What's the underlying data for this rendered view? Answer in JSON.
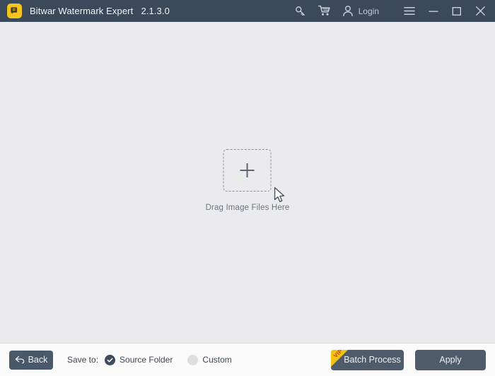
{
  "window": {
    "app_icon": "app-logo-icon",
    "title": "Bitwar Watermark Expert",
    "version": "2.1.3.0"
  },
  "titlebar": {
    "actions": [
      {
        "name": "key-icon",
        "label": "",
        "title": "Activate"
      },
      {
        "name": "cart-icon",
        "label": "",
        "title": "Store"
      },
      {
        "name": "user-icon",
        "label": "Login"
      }
    ],
    "login_label": "Login",
    "menu_icon": "hamburger-menu-icon",
    "minimize_icon": "minimize-icon",
    "maximize_icon": "maximize-icon",
    "close_icon": "close-icon"
  },
  "main": {
    "dropzone": {
      "plus_icon": "plus-icon",
      "cursor_icon": "cursor-arrow-icon",
      "label": "Drag Image Files Here"
    }
  },
  "bottombar": {
    "back_button": {
      "label": "Back",
      "icon": "back-arrow-icon"
    },
    "save_to_label": "Save to:",
    "save_options": [
      {
        "label": "Source Folder",
        "selected": true
      },
      {
        "label": "Custom",
        "selected": false
      }
    ],
    "batch_button": {
      "label": "Batch Process",
      "badge": "VIP"
    },
    "apply_button": {
      "label": "Apply"
    }
  },
  "colors": {
    "titlebar_bg": "#3b4a5a",
    "content_bg": "#ebebed",
    "bottombar_bg": "#fbfbfc",
    "button_bg": "#4d5b6b",
    "accent_yellow": "#f2c312",
    "app_icon_bg": "#f5c41f",
    "text_dark": "#3f4752",
    "text_light": "#eef0f3"
  }
}
